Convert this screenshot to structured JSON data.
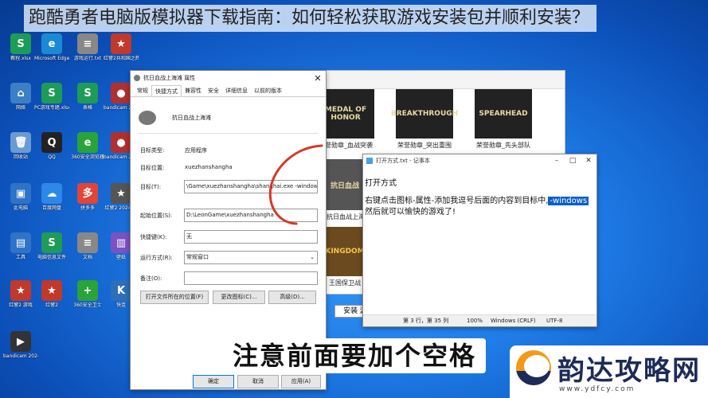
{
  "headline": "跑酷勇者电脑版模拟器下载指南：如何轻松获取游戏安装包并顺利安装？",
  "desktop_icons": [
    {
      "label": "教程.xlsx",
      "glyph": "S",
      "color": "#1e9c57"
    },
    {
      "label": "Microsoft Edge",
      "glyph": "e",
      "color": "#1a8ad4"
    },
    {
      "label": "游戏运行.txt",
      "glyph": "≡",
      "color": "#888888"
    },
    {
      "label": "红警2共和国之辉 2024-09-...",
      "glyph": "★",
      "color": "#c0392b"
    },
    {
      "label": "网络",
      "glyph": "⌂",
      "color": "#3c7fc4"
    },
    {
      "label": "PC游戏专题.xlsx",
      "glyph": "S",
      "color": "#1e9c57"
    },
    {
      "label": "表格",
      "glyph": "S",
      "color": "#1e9c57"
    },
    {
      "label": "bandicam 2024-09-...",
      "glyph": "●",
      "color": "#b03030"
    },
    {
      "label": "回收站",
      "glyph": "🗑",
      "color": "#6b9bd1"
    },
    {
      "label": "QQ",
      "glyph": "Q",
      "color": "#222222"
    },
    {
      "label": "360安全浏览器",
      "glyph": "e",
      "color": "#2aa33a"
    },
    {
      "label": "bandicam 2024-09-...",
      "glyph": "●",
      "color": "#b03030"
    },
    {
      "label": "此电脑",
      "glyph": "▣",
      "color": "#2f73c9"
    },
    {
      "label": "百度网盘",
      "glyph": "☁",
      "color": "#2d88e8"
    },
    {
      "label": "拼多多",
      "glyph": "多",
      "color": "#e0453a"
    },
    {
      "label": "红警2 2024-...",
      "glyph": "★",
      "color": "#555555"
    },
    {
      "label": "工具",
      "glyph": "▤",
      "color": "#2f73c9"
    },
    {
      "label": "电脑信息文件",
      "glyph": "S",
      "color": "#1e9c57"
    },
    {
      "label": "文档",
      "glyph": "≡",
      "color": "#888888"
    },
    {
      "label": "壁纸",
      "glyph": "▥",
      "color": "#7a52c4"
    },
    {
      "label": "红警2 游戏",
      "glyph": "★",
      "color": "#c0392b"
    },
    {
      "label": "红警2",
      "glyph": "★",
      "color": "#c0392b"
    },
    {
      "label": "360安全卫士",
      "glyph": "+",
      "color": "#2aa33a"
    },
    {
      "label": "快连",
      "glyph": "K",
      "color": "#2d6fb8"
    },
    {
      "label": "bandicam 2024-03-...",
      "glyph": "▶",
      "color": "#333333"
    }
  ],
  "explorer": {
    "thumbnails": [
      {
        "title": "MEDAL OF HONOR",
        "caption": "荣誉勋章_血战突袭"
      },
      {
        "title": "BREAKTHROUGH",
        "caption": "荣誉勋章_突出重围"
      },
      {
        "title": "SPEARHEAD",
        "caption": "荣誉勋章_先头部队"
      },
      {
        "title": "抗日血战",
        "caption": "抗日血战上海滩"
      },
      {
        "title": "KINGDOM",
        "caption": "王国保卫战"
      }
    ],
    "install_label": "安装 游"
  },
  "dialog": {
    "title": "抗日血战上海滩 属性",
    "tabs": [
      "常规",
      "快捷方式",
      "兼容性",
      "安全",
      "详细信息",
      "以前的版本"
    ],
    "active_tab": "快捷方式",
    "name": "抗日血战上海滩",
    "target_type_label": "目标类型:",
    "target_type_value": "应用程序",
    "target_location_label": "目标位置:",
    "target_location_value": "xuezhanshangha",
    "target_label": "目标(T):",
    "target_value": "\\Game\\xuezhanshangha\\shanghai.exe  -windows",
    "start_in_label": "起始位置(S):",
    "start_in_value": "D:\\LeonGame\\xuezhanshangha",
    "hotkey_label": "快捷键(K):",
    "hotkey_value": "无",
    "run_label": "运行方式(R):",
    "run_value": "常规窗口",
    "comment_label": "备注(O):",
    "comment_value": "",
    "open_location_btn": "打开文件所在的位置(F)",
    "change_icon_btn": "更改图标(C)...",
    "advanced_btn": "高级(D)...",
    "ok_btn": "确定",
    "cancel_btn": "取消",
    "apply_btn": "应用(A)"
  },
  "notepad": {
    "title": "打开方式.txt - 记事本",
    "line1": "打开方式",
    "line2_prefix": "右键点击图标-属性-添加我逗号后面的内容到目标中,",
    "line2_highlight": "-windows",
    "line3": "然后就可以愉快的游戏了!",
    "status_pos": "第 3 行，第 35 列",
    "status_zoom": "100%",
    "status_eol": "Windows (CRLF)",
    "status_enc": "UTF-8"
  },
  "caption": "注意前面要加个空格",
  "watermark": {
    "title": "韵达攻略网",
    "url": "www.ydfcy.com"
  }
}
